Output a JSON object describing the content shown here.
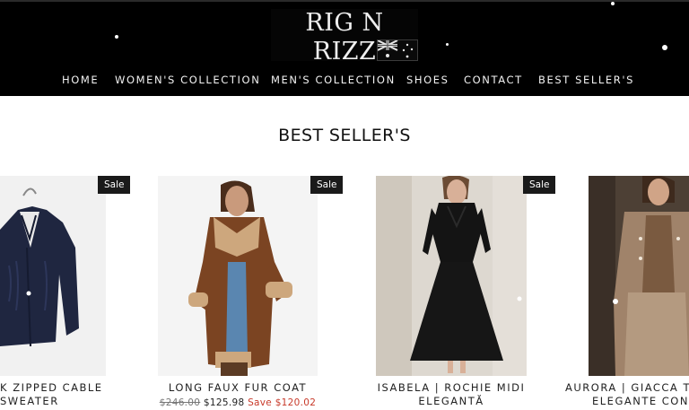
{
  "store": {
    "logo": "RIG N RIZZ",
    "flag_icon": "australia-flag-icon"
  },
  "nav": {
    "items": [
      "HOME",
      "WOMEN'S COLLECTION",
      "MEN'S COLLECTION",
      "SHOES",
      "CONTACT",
      "BEST SELLER'S"
    ]
  },
  "section": {
    "title": "BEST SELLER'S"
  },
  "products": [
    {
      "title_line1": "K ZIPPED CABLE",
      "title_line2": "SWEATER",
      "badge": "Sale"
    },
    {
      "title_line1": "LONG FAUX FUR COAT",
      "title_line2": "",
      "badge": "Sale",
      "price_old": "$246.00",
      "price_new": "$125.98",
      "price_save": "Save $120.02"
    },
    {
      "title_line1": "ISABELA | ROCHIE MIDI",
      "title_line2": "ELEGANTĂ",
      "badge": "Sale"
    },
    {
      "title_line1": "AURORA | GIACCA TE",
      "title_line2": "ELEGANTE CON",
      "badge": ""
    }
  ],
  "colors": {
    "header_bg": "#000000",
    "header_text": "#f2f2f2",
    "badge_bg": "#1a1a1a",
    "save_text": "#c83a2a"
  }
}
